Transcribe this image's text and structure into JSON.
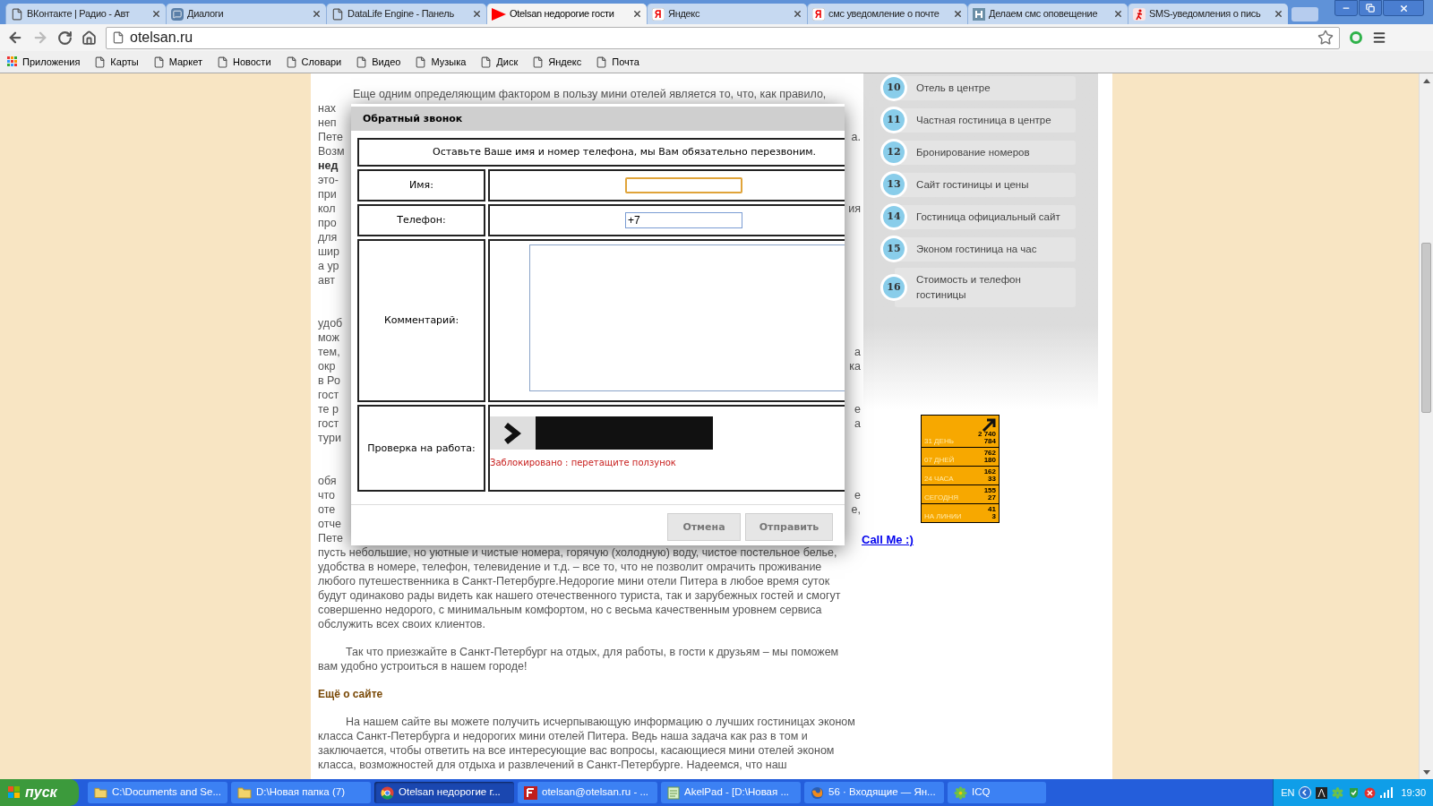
{
  "browser": {
    "tabs": [
      {
        "title": "ВКонтакте | Радио - Авт",
        "kind": "page",
        "selected": false
      },
      {
        "title": "Диалоги",
        "kind": "chat",
        "selected": false
      },
      {
        "title": "DataLife Engine - Панель",
        "kind": "page",
        "selected": false
      },
      {
        "title": "Otelsan недорогие гости",
        "kind": "play",
        "selected": true
      },
      {
        "title": "Яндекс",
        "kind": "yandex",
        "selected": false
      },
      {
        "title": "смс уведомление о почте",
        "kind": "yandex",
        "selected": false
      },
      {
        "title": "Делаем смс оповещение",
        "kind": "site",
        "selected": false
      },
      {
        "title": "SMS-уведомления о пись",
        "kind": "sms",
        "selected": false
      }
    ],
    "address": "otelsan.ru",
    "bookmarks": [
      {
        "label": "Приложения",
        "kind": "apps"
      },
      {
        "label": "Карты",
        "kind": "page"
      },
      {
        "label": "Маркет",
        "kind": "page"
      },
      {
        "label": "Новости",
        "kind": "page"
      },
      {
        "label": "Словари",
        "kind": "page"
      },
      {
        "label": "Видео",
        "kind": "page"
      },
      {
        "label": "Музыка",
        "kind": "page"
      },
      {
        "label": "Диск",
        "kind": "page"
      },
      {
        "label": "Яндекс",
        "kind": "page"
      },
      {
        "label": "Почта",
        "kind": "page"
      }
    ]
  },
  "article": {
    "first_line": "Еще одним определяющим фактором в пользу мини отелей является то, что, как правило,",
    "covered_blocks": [
      [
        {
          "left": "нах",
          "bold": false
        },
        {
          "left": "неп",
          "bold": false
        },
        {
          "left": "Пете",
          "right": "а.",
          "bold": false
        },
        {
          "left": "Возм",
          "bold": false
        },
        {
          "left": "нед",
          "bold": true
        },
        {
          "left": "это-",
          "bold": false
        },
        {
          "left": "при",
          "bold": false
        },
        {
          "left": "кол",
          "right": "ия",
          "bold": false
        },
        {
          "left": "про",
          "bold": false
        },
        {
          "left": "для",
          "bold": false
        },
        {
          "left": "шир",
          "bold": false
        },
        {
          "left": "а ур",
          "bold": false
        },
        {
          "left": "авт",
          "bold": false
        }
      ],
      [
        {
          "left": "удоб",
          "bold": false
        },
        {
          "left": "мож",
          "bold": false
        },
        {
          "left": "тем,",
          "right": "а",
          "bold": false
        },
        {
          "left": "окр",
          "right": "ка",
          "bold": false
        },
        {
          "left": "в Ро",
          "bold": false
        },
        {
          "left": "гост",
          "bold": false
        },
        {
          "left": "те р",
          "right": "е",
          "bold": false
        },
        {
          "left": "гост",
          "right": "а",
          "bold": false
        },
        {
          "left": "тури",
          "bold": false
        }
      ],
      [
        {
          "left": "обя",
          "bold": false
        },
        {
          "left": "что",
          "right": "е",
          "bold": false
        },
        {
          "left": "оте",
          "right": "е,",
          "bold": false
        },
        {
          "left": "отче",
          "bold": false
        },
        {
          "left": "Пете",
          "bold": false
        }
      ]
    ],
    "paragraphs": [
      {
        "kind": "text",
        "text": "пусть небольшие, но уютные и чистые номера, горячую (холодную) воду, чистое постельное белье, удобства в номере, телефон, телевидение и т.д. – все то, что не позволит омрачить проживание любого путешественника в Санкт-Петербурге.Недорогие мини отели Питера в любое время суток будут одинаково рады видеть как нашего отечественного туриста, так и зарубежных гостей и смогут совершенно недорого, с минимальным комфортом, но с весьма качественным уровнем сервиса обслужить всех своих клиентов."
      },
      {
        "kind": "indented",
        "text": "Так что приезжайте в Санкт-Петербург на отдых, для работы, в гости к друзьям – мы поможем вам удобно устроиться в нашем городе!"
      },
      {
        "kind": "heading",
        "text": "Ещё о сайте"
      },
      {
        "kind": "indented",
        "text": "На нашем сайте вы можете получить исчерпывающую информацию о лучших гостиницах эконом класса Санкт-Петербурга и недорогих мини отелей Питера. Ведь наша задача как раз в том и заключается, чтобы ответить на все интересующие вас вопросы, касающиеся мини отелей эконом класса, возможностей для отдыха и развлечений в Санкт-Петербурге. Надеемся, что наш"
      }
    ]
  },
  "sidebar": {
    "items": [
      {
        "number": "10",
        "label": "Отель в центре"
      },
      {
        "number": "11",
        "label": "Частная гостиница в центре"
      },
      {
        "number": "12",
        "label": "Бронирование номеров"
      },
      {
        "number": "13",
        "label": "Сайт гостиницы и цены"
      },
      {
        "number": "14",
        "label": "Гостиница официальный сайт"
      },
      {
        "number": "15",
        "label": "Эконом гостиница на час"
      },
      {
        "number": "16",
        "label": "Стоимость и телефон гостиницы"
      }
    ],
    "counter": [
      {
        "label": "31 ДЕНЬ",
        "total": "2 740",
        "unique": "784"
      },
      {
        "label": "07 ДНЕЙ",
        "total": "762",
        "unique": "180"
      },
      {
        "label": "24 ЧАСА",
        "total": "162",
        "unique": "33"
      },
      {
        "label": "СЕГОДНЯ",
        "total": "155",
        "unique": "27"
      },
      {
        "label": "НА ЛИНИИ",
        "total": "41",
        "unique": "3"
      }
    ],
    "link": "Call Me :)"
  },
  "dialog": {
    "title": "Обратный звонок",
    "message": "Оставьте Ваше имя и номер телефона, мы Вам обязательно перезвоним.",
    "fields": [
      {
        "label": "Имя:",
        "kind": "input",
        "focused": true
      },
      {
        "label": "Телефон:",
        "kind": "input",
        "value": "+7",
        "focused": false
      },
      {
        "label": "Комментарий:",
        "kind": "textarea",
        "focused": false
      }
    ],
    "captcha": {
      "label": "Проверка на работа:",
      "level": 0,
      "status": "Заблокировано : перетащите ползунок"
    },
    "buttons": [
      "Отмена",
      "Отправить"
    ]
  },
  "taskbar": {
    "start": "пуск",
    "items": [
      {
        "label": "C:\\Documents and Se...",
        "kind": "folder",
        "selected": false
      },
      {
        "label": "D:\\Новая папка (7)",
        "kind": "folder",
        "selected": false
      },
      {
        "label": "Otelsan недорогие г...",
        "kind": "chrome",
        "selected": true
      },
      {
        "label": "otelsan@otelsan.ru - ...",
        "kind": "filezilla",
        "selected": false
      },
      {
        "label": "AkelPad - [D:\\Новая ...",
        "kind": "notepad",
        "selected": false
      },
      {
        "label": "56 · Входящие — Ян...",
        "kind": "firefox",
        "selected": false
      },
      {
        "label": "ICQ",
        "kind": "icq",
        "selected": false
      }
    ],
    "language": "EN",
    "time": "19:30"
  }
}
